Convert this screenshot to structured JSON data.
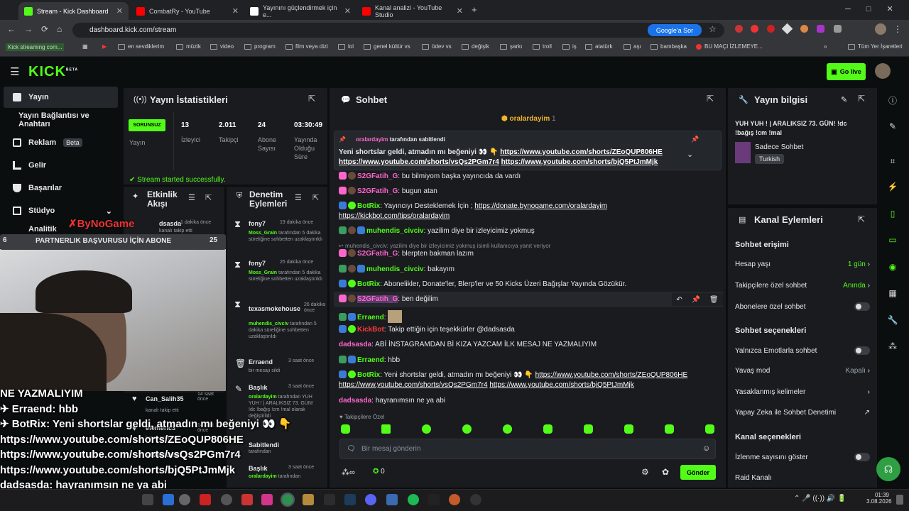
{
  "browser": {
    "tabs": [
      {
        "label": "Stream - Kick Dashboard",
        "color": "#53fc18"
      },
      {
        "label": "CombatRy - YouTube",
        "color": "#ff0000"
      },
      {
        "label": "Yayınını güçlendirmek için e...",
        "color": "#ffffff"
      },
      {
        "label": "Kanal analizi - YouTube Studio",
        "color": "#ff0000"
      }
    ],
    "url": "dashboard.kick.com/stream",
    "google_button": "Google'a Sor",
    "bookmarks": [
      "Kick streaming com...",
      "en sevdiklerim",
      "müzik",
      "video",
      "program",
      "film veya dizi",
      "lol",
      "genel kültür vs",
      "ödev vs",
      "değişik",
      "şarkı",
      "troll",
      "iş",
      "atatürk",
      "aşı",
      "bambaşka",
      "BU MAÇI İZLEMEYE..."
    ],
    "bookmarks_all": "Tüm Yer İşaretleri"
  },
  "header": {
    "logo": "KICK",
    "logo_sup": "BETA",
    "go_live": "Go live"
  },
  "nav": [
    "Yayın",
    "Yayın Bağlantısı ve Anahtarı",
    "Reklam",
    "Gelir",
    "Başarılar",
    "Stüdyo",
    "Analitik"
  ],
  "nav_beta": "Beta",
  "stats": {
    "title": "Yayın İstatistikleri",
    "status": "SORUNSUZ",
    "status_label": "Yayın",
    "viewers": "13",
    "viewers_label": "İzleyici",
    "followers": "2.011",
    "followers_label": "Takipçi",
    "subs": "24",
    "subs_label": "Abone Sayısı",
    "duration": "03:30:49",
    "duration_label": "Yayında Olduğu Süre",
    "success": "Stream started successfully."
  },
  "activity": {
    "title": "Etkinlik Akışı",
    "items": [
      {
        "name": "dsasda",
        "time": "1 dakika önce",
        "text": "kanalı takip etti"
      },
      {
        "name": "Can_Salih35",
        "time": "14 saat önce",
        "text": "kanalı takip etti"
      },
      {
        "name": "efemeric3",
        "time": "14 saat önce",
        "text": "kanalı takip etti"
      },
      {
        "name": "silverpuma1",
        "time": "",
        "text": ""
      }
    ]
  },
  "moderation": {
    "title": "Denetim Eylemleri",
    "items": [
      {
        "name": "fony7",
        "time": "19 dakika önce",
        "user": "Moss_Grain",
        "text": "tarafından 5 dakika süreliğine sohbetten uzaklaştırıldı"
      },
      {
        "name": "fony7",
        "time": "25 dakika önce",
        "user": "Moss_Grain",
        "text": "tarafından 5 dakika süreliğine sohbetten uzaklaştırıldı"
      },
      {
        "name": "texasmokehouse",
        "time": "26 dakika önce",
        "user": "muhendis_civciv",
        "text": "tarafından 5 dakika süreliğine sohbetten uzaklaştırıldı"
      },
      {
        "name": "Erraend",
        "time": "3 saat önce",
        "user": "",
        "text": "bir mesajı sildi"
      },
      {
        "name": "Başlık",
        "time": "3 saat önce",
        "user": "oralardayim",
        "text": "tarafından YUH YUH ! | ARALIKSIZ 73. GÜN! !dc !bağış !cm !mal olarak değiştirildi"
      },
      {
        "name": "Sabitlendi",
        "time": "",
        "user": "",
        "text": "tarafından"
      },
      {
        "name": "Başlık",
        "time": "3 saat önce",
        "user": "oralardayim",
        "text": "tarafından"
      }
    ]
  },
  "chat": {
    "title": "Sohbet",
    "streamer": "oralardayim",
    "streamer_count": "1",
    "pinned_by": "oralardayim",
    "pinned_label": "tarafından sabitlendi",
    "pinned_text": "Yeni shortslar geldi, atmadın mı beğeniyi 👀 👇 ",
    "pinned_link1": "https://www.youtube.com/shorts/ZEoQUP806HE",
    "pinned_link2": "https://www.youtube.com/shorts/vsQs2PGm7r4",
    "pinned_link3": "https://www.youtube.com/shorts/bjQ5PtJmMjk",
    "messages": [
      {
        "user": "S2GFatih_G",
        "color": "#ff66cc",
        "text": "bu bilmiyom başka yayıncıda da vardı"
      },
      {
        "user": "S2GFatih_G",
        "color": "#ff66cc",
        "text": "bugun atan"
      },
      {
        "user": "BotRix",
        "color": "#53fc18",
        "text": "Yayıncıyı Desteklemek İçin ; ",
        "link": "https://donate.bynogame.com/oralardayim",
        "text2": "",
        "link2": "https://kickbot.com/tips/oralardayim"
      },
      {
        "user": "muhendis_civciv",
        "color": "#53fc18",
        "text": "yazilim diye bir izleyicimiz yokmuş"
      },
      {
        "user": "",
        "color": "",
        "text": "muhendis_civciv: yazilim diye bir izleyicimiz yokmuş isimli kullanıcıya yanıt veriyor"
      },
      {
        "user": "S2GFatih_G",
        "color": "#ff66cc",
        "text": "blerpten bakman lazım"
      },
      {
        "user": "muhendis_civciv",
        "color": "#53fc18",
        "text": "bakayım"
      },
      {
        "user": "BotRix",
        "color": "#53fc18",
        "text": "Abonelikler, Donate'ler, Blerp'ler ve 50 Kicks Üzeri Bağışlar Yayında Gözükür."
      },
      {
        "user": "S2GFatih_G",
        "color": "#ff66cc",
        "text": "ben değilim"
      },
      {
        "user": "Erraend",
        "color": "#53fc18",
        "text": ""
      },
      {
        "user": "KickBot",
        "color": "#ff3b3b",
        "text": "Takip ettiğin için teşekkürler @dadsasda"
      },
      {
        "user": "dadsasda",
        "color": "#ff66cc",
        "text": "ABİ İNSTAGRAMDAN Bİ KIZA YAZCAM İLK MESAJ NE YAZMALIYIM"
      },
      {
        "user": "Erraend",
        "color": "#53fc18",
        "text": "hbb"
      },
      {
        "user": "BotRix",
        "color": "#53fc18",
        "text": "Yeni shortslar geldi, atmadın mı beğeniyi 👀 👇 ",
        "link": "https://www.youtube.com/shorts/ZEoQUP806HE",
        "link2": "https://www.youtube.com/shorts/vsQs2PGm7r4",
        "link3": "https://www.youtube.com/shorts/bjQ5PtJmMjk"
      },
      {
        "user": "dadsasda",
        "color": "#ff66cc",
        "text": "hayranımsın ne ya abi"
      }
    ],
    "followers_only": "Takipçilere Özel",
    "placeholder": "Bir mesaj gönderin",
    "points": "0",
    "send": "Gönder"
  },
  "info": {
    "title": "Yayın bilgisi",
    "stream_title": "YUH YUH ! | ARALIKSIZ 73. GÜN! !dc !bağış !cm !mal",
    "category": "Sadece Sohbet",
    "language": "Turkish"
  },
  "channel_actions": {
    "title": "Kanal Eylemleri",
    "chat_access": "Sohbet erişimi",
    "account_age": "Hesap yaşı",
    "account_age_val": "1 gün",
    "followers_chat": "Takipçilere özel sohbet",
    "followers_chat_val": "Anında",
    "subs_chat": "Abonelere özel sohbet",
    "chat_options": "Sohbet seçenekleri",
    "emote_only": "Yalnızca Emotlarla sohbet",
    "slow_mode": "Yavaş mod",
    "slow_mode_val": "Kapalı",
    "banned_words": "Yasaklanmış kelimeler",
    "ai_mod": "Yapay Zeka ile Sohbet Denetimi",
    "channel_options": "Kanal seçenekleri",
    "show_viewers": "İzlenme sayısını göster",
    "raid": "Raid Kanalı"
  },
  "overlay": {
    "bar_num": "6",
    "bar_text": "PARTNERLIK BAŞVURUSU İÇİN ABONE",
    "bar_count": "25",
    "line1": "NE YAZMALIYIM",
    "line2": "✈ Erraend: hbb",
    "line3": "✈ BotRix: Yeni shortslar geldi, atmadın mı beğeniyi 👀 👇",
    "line4": "https://www.youtube.com/shorts/ZEoQUP806HE",
    "line5": "https://www.youtube.com/shorts/vsQs2PGm7r4",
    "line6": "https://www.youtube.com/shorts/bjQ5PtJmMjk",
    "line7": "dadsasda: hayranımsın ne ya abi"
  },
  "taskbar": {
    "time": "01:39",
    "date": "3.08.2026"
  }
}
